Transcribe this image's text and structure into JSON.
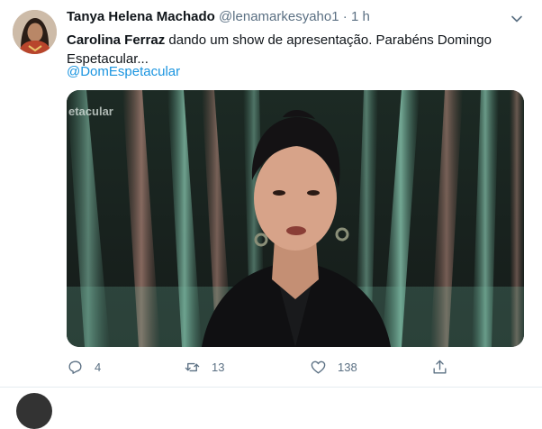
{
  "tweet": {
    "author_name": "Tanya Helena Machado",
    "handle": "@lenamarkesyaho1",
    "separator": "·",
    "time": "1 h",
    "text_mention": "Carolina Ferraz",
    "text_body": " dando um show de apresentação. Parabéns Domingo Espetacular...",
    "hashtag": "@DomEspetacular",
    "media": {
      "overlay_text": "etacular"
    },
    "actions": {
      "reply_count": "4",
      "retweet_count": "13",
      "like_count": "138"
    }
  },
  "icons": {
    "caret": "chevron-down-icon",
    "reply": "reply-icon",
    "retweet": "retweet-icon",
    "like": "heart-icon",
    "share": "share-icon"
  },
  "colors": {
    "link": "#1b95e0",
    "secondary": "#5b7083"
  }
}
